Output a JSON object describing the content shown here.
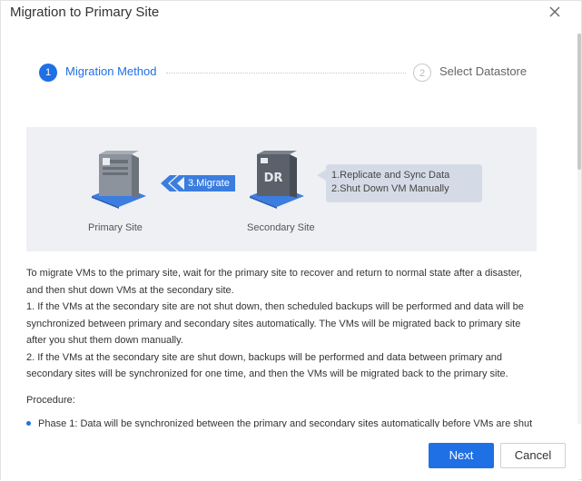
{
  "dialog": {
    "title": "Migration to Primary Site"
  },
  "steps": [
    {
      "number": "1",
      "label": "Migration Method",
      "state": "active"
    },
    {
      "number": "2",
      "label": "Select Datastore",
      "state": "inactive"
    }
  ],
  "diagram": {
    "primary_label": "Primary Site",
    "secondary_label": "Secondary Site",
    "migrate_label": "3.Migrate",
    "dr_text": "DR",
    "callout_lines": [
      "1.Replicate and Sync Data",
      "2.Shut Down VM Manually"
    ]
  },
  "description": [
    "To migrate VMs to the primary site, wait for the primary site to recover and return to normal state after a disaster, and then shut down VMs at the secondary site.",
    "1. If the VMs at the secondary site are not shut down, then scheduled backups will be performed and data will be synchronized between primary and secondary sites automatically. The VMs will be migrated back to primary site after you shut them down manually.",
    "2. If the VMs at the secondary site are shut down, backups will be performed and data between primary and secondary sites will be synchronized for one time, and then the VMs will be migrated back to the primary site."
  ],
  "procedure_label": "Procedure:",
  "phase1": "Phase 1: Data will be synchronized between the primary and secondary sites automatically before VMs are shut",
  "buttons": {
    "next": "Next",
    "cancel": "Cancel"
  },
  "colors": {
    "accent": "#1f6fe5",
    "diagram_bg": "#eef0f4"
  }
}
